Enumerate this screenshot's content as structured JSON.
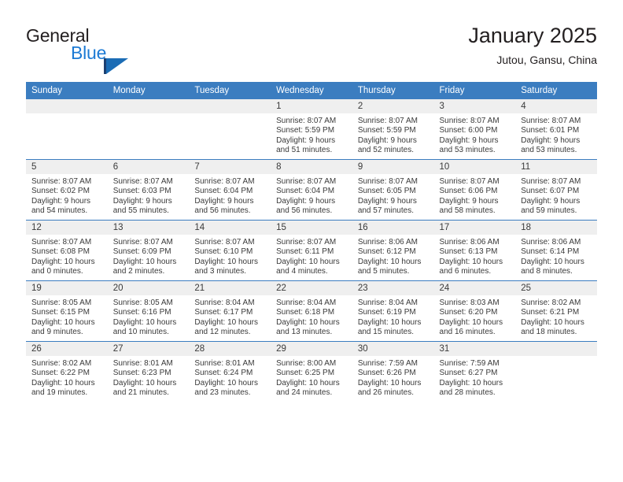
{
  "brand": {
    "name_part1": "General",
    "name_part2": "Blue",
    "logo_icon": "flag-triangle-icon",
    "accent_color": "#1c7ad4",
    "header_color": "#3b7dc0"
  },
  "header": {
    "title": "January 2025",
    "location": "Jutou, Gansu, China"
  },
  "weekdays": [
    "Sunday",
    "Monday",
    "Tuesday",
    "Wednesday",
    "Thursday",
    "Friday",
    "Saturday"
  ],
  "weeks": [
    [
      {
        "day": "",
        "empty": true,
        "sunrise": "",
        "sunset": "",
        "daylight1": "",
        "daylight2": ""
      },
      {
        "day": "",
        "empty": true,
        "sunrise": "",
        "sunset": "",
        "daylight1": "",
        "daylight2": ""
      },
      {
        "day": "",
        "empty": true,
        "sunrise": "",
        "sunset": "",
        "daylight1": "",
        "daylight2": ""
      },
      {
        "day": "1",
        "empty": false,
        "sunrise": "Sunrise: 8:07 AM",
        "sunset": "Sunset: 5:59 PM",
        "daylight1": "Daylight: 9 hours",
        "daylight2": "and 51 minutes."
      },
      {
        "day": "2",
        "empty": false,
        "sunrise": "Sunrise: 8:07 AM",
        "sunset": "Sunset: 5:59 PM",
        "daylight1": "Daylight: 9 hours",
        "daylight2": "and 52 minutes."
      },
      {
        "day": "3",
        "empty": false,
        "sunrise": "Sunrise: 8:07 AM",
        "sunset": "Sunset: 6:00 PM",
        "daylight1": "Daylight: 9 hours",
        "daylight2": "and 53 minutes."
      },
      {
        "day": "4",
        "empty": false,
        "sunrise": "Sunrise: 8:07 AM",
        "sunset": "Sunset: 6:01 PM",
        "daylight1": "Daylight: 9 hours",
        "daylight2": "and 53 minutes."
      }
    ],
    [
      {
        "day": "5",
        "empty": false,
        "sunrise": "Sunrise: 8:07 AM",
        "sunset": "Sunset: 6:02 PM",
        "daylight1": "Daylight: 9 hours",
        "daylight2": "and 54 minutes."
      },
      {
        "day": "6",
        "empty": false,
        "sunrise": "Sunrise: 8:07 AM",
        "sunset": "Sunset: 6:03 PM",
        "daylight1": "Daylight: 9 hours",
        "daylight2": "and 55 minutes."
      },
      {
        "day": "7",
        "empty": false,
        "sunrise": "Sunrise: 8:07 AM",
        "sunset": "Sunset: 6:04 PM",
        "daylight1": "Daylight: 9 hours",
        "daylight2": "and 56 minutes."
      },
      {
        "day": "8",
        "empty": false,
        "sunrise": "Sunrise: 8:07 AM",
        "sunset": "Sunset: 6:04 PM",
        "daylight1": "Daylight: 9 hours",
        "daylight2": "and 56 minutes."
      },
      {
        "day": "9",
        "empty": false,
        "sunrise": "Sunrise: 8:07 AM",
        "sunset": "Sunset: 6:05 PM",
        "daylight1": "Daylight: 9 hours",
        "daylight2": "and 57 minutes."
      },
      {
        "day": "10",
        "empty": false,
        "sunrise": "Sunrise: 8:07 AM",
        "sunset": "Sunset: 6:06 PM",
        "daylight1": "Daylight: 9 hours",
        "daylight2": "and 58 minutes."
      },
      {
        "day": "11",
        "empty": false,
        "sunrise": "Sunrise: 8:07 AM",
        "sunset": "Sunset: 6:07 PM",
        "daylight1": "Daylight: 9 hours",
        "daylight2": "and 59 minutes."
      }
    ],
    [
      {
        "day": "12",
        "empty": false,
        "sunrise": "Sunrise: 8:07 AM",
        "sunset": "Sunset: 6:08 PM",
        "daylight1": "Daylight: 10 hours",
        "daylight2": "and 0 minutes."
      },
      {
        "day": "13",
        "empty": false,
        "sunrise": "Sunrise: 8:07 AM",
        "sunset": "Sunset: 6:09 PM",
        "daylight1": "Daylight: 10 hours",
        "daylight2": "and 2 minutes."
      },
      {
        "day": "14",
        "empty": false,
        "sunrise": "Sunrise: 8:07 AM",
        "sunset": "Sunset: 6:10 PM",
        "daylight1": "Daylight: 10 hours",
        "daylight2": "and 3 minutes."
      },
      {
        "day": "15",
        "empty": false,
        "sunrise": "Sunrise: 8:07 AM",
        "sunset": "Sunset: 6:11 PM",
        "daylight1": "Daylight: 10 hours",
        "daylight2": "and 4 minutes."
      },
      {
        "day": "16",
        "empty": false,
        "sunrise": "Sunrise: 8:06 AM",
        "sunset": "Sunset: 6:12 PM",
        "daylight1": "Daylight: 10 hours",
        "daylight2": "and 5 minutes."
      },
      {
        "day": "17",
        "empty": false,
        "sunrise": "Sunrise: 8:06 AM",
        "sunset": "Sunset: 6:13 PM",
        "daylight1": "Daylight: 10 hours",
        "daylight2": "and 6 minutes."
      },
      {
        "day": "18",
        "empty": false,
        "sunrise": "Sunrise: 8:06 AM",
        "sunset": "Sunset: 6:14 PM",
        "daylight1": "Daylight: 10 hours",
        "daylight2": "and 8 minutes."
      }
    ],
    [
      {
        "day": "19",
        "empty": false,
        "sunrise": "Sunrise: 8:05 AM",
        "sunset": "Sunset: 6:15 PM",
        "daylight1": "Daylight: 10 hours",
        "daylight2": "and 9 minutes."
      },
      {
        "day": "20",
        "empty": false,
        "sunrise": "Sunrise: 8:05 AM",
        "sunset": "Sunset: 6:16 PM",
        "daylight1": "Daylight: 10 hours",
        "daylight2": "and 10 minutes."
      },
      {
        "day": "21",
        "empty": false,
        "sunrise": "Sunrise: 8:04 AM",
        "sunset": "Sunset: 6:17 PM",
        "daylight1": "Daylight: 10 hours",
        "daylight2": "and 12 minutes."
      },
      {
        "day": "22",
        "empty": false,
        "sunrise": "Sunrise: 8:04 AM",
        "sunset": "Sunset: 6:18 PM",
        "daylight1": "Daylight: 10 hours",
        "daylight2": "and 13 minutes."
      },
      {
        "day": "23",
        "empty": false,
        "sunrise": "Sunrise: 8:04 AM",
        "sunset": "Sunset: 6:19 PM",
        "daylight1": "Daylight: 10 hours",
        "daylight2": "and 15 minutes."
      },
      {
        "day": "24",
        "empty": false,
        "sunrise": "Sunrise: 8:03 AM",
        "sunset": "Sunset: 6:20 PM",
        "daylight1": "Daylight: 10 hours",
        "daylight2": "and 16 minutes."
      },
      {
        "day": "25",
        "empty": false,
        "sunrise": "Sunrise: 8:02 AM",
        "sunset": "Sunset: 6:21 PM",
        "daylight1": "Daylight: 10 hours",
        "daylight2": "and 18 minutes."
      }
    ],
    [
      {
        "day": "26",
        "empty": false,
        "sunrise": "Sunrise: 8:02 AM",
        "sunset": "Sunset: 6:22 PM",
        "daylight1": "Daylight: 10 hours",
        "daylight2": "and 19 minutes."
      },
      {
        "day": "27",
        "empty": false,
        "sunrise": "Sunrise: 8:01 AM",
        "sunset": "Sunset: 6:23 PM",
        "daylight1": "Daylight: 10 hours",
        "daylight2": "and 21 minutes."
      },
      {
        "day": "28",
        "empty": false,
        "sunrise": "Sunrise: 8:01 AM",
        "sunset": "Sunset: 6:24 PM",
        "daylight1": "Daylight: 10 hours",
        "daylight2": "and 23 minutes."
      },
      {
        "day": "29",
        "empty": false,
        "sunrise": "Sunrise: 8:00 AM",
        "sunset": "Sunset: 6:25 PM",
        "daylight1": "Daylight: 10 hours",
        "daylight2": "and 24 minutes."
      },
      {
        "day": "30",
        "empty": false,
        "sunrise": "Sunrise: 7:59 AM",
        "sunset": "Sunset: 6:26 PM",
        "daylight1": "Daylight: 10 hours",
        "daylight2": "and 26 minutes."
      },
      {
        "day": "31",
        "empty": false,
        "sunrise": "Sunrise: 7:59 AM",
        "sunset": "Sunset: 6:27 PM",
        "daylight1": "Daylight: 10 hours",
        "daylight2": "and 28 minutes."
      },
      {
        "day": "",
        "empty": true,
        "sunrise": "",
        "sunset": "",
        "daylight1": "",
        "daylight2": ""
      }
    ]
  ]
}
